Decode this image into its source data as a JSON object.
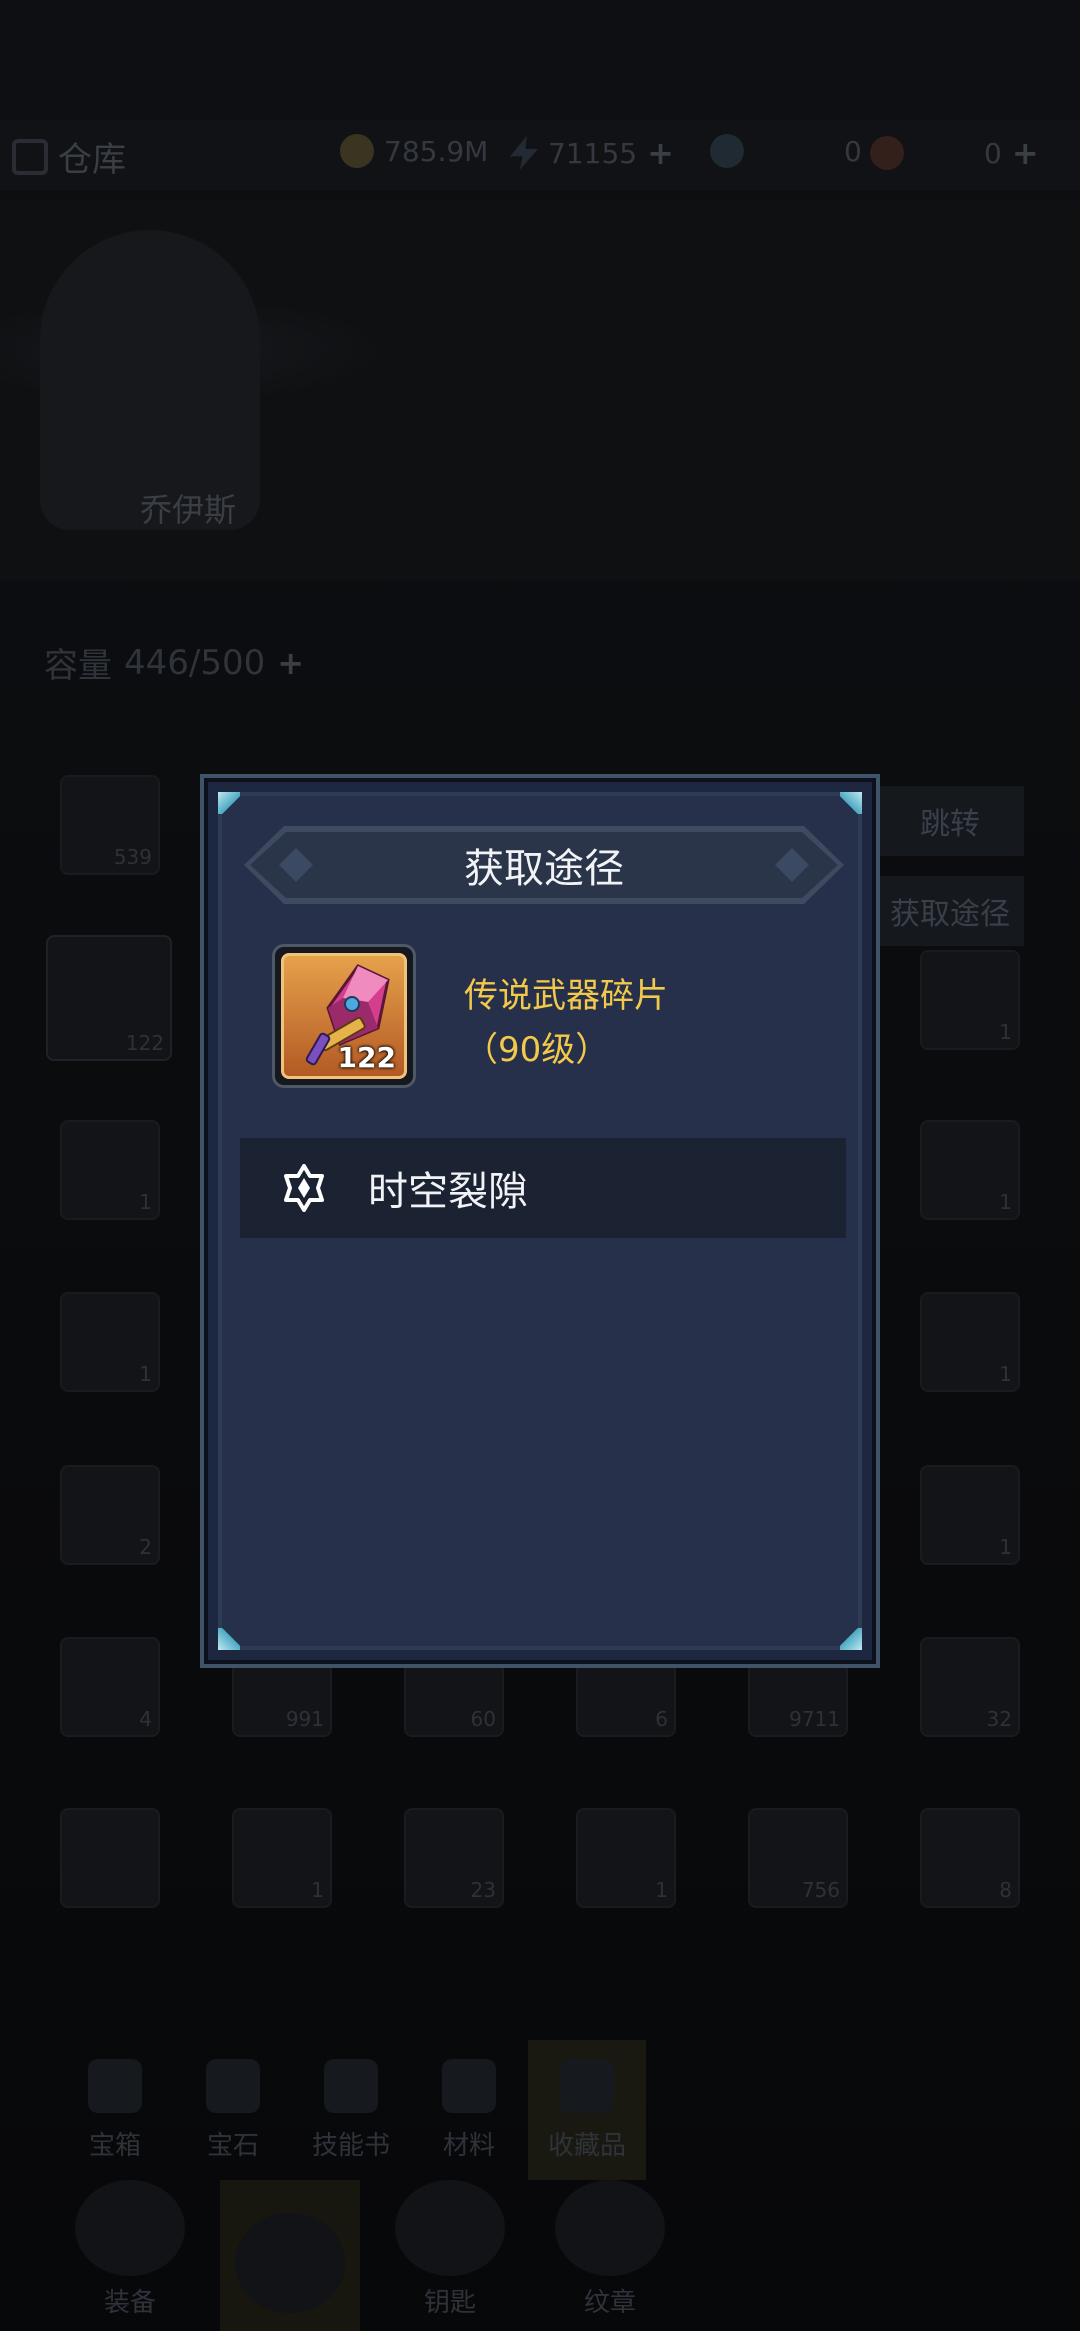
{
  "background": {
    "title": "仓库",
    "resources": [
      {
        "icon": "gold-coin-icon",
        "value": "785.9M"
      },
      {
        "icon": "energy-icon",
        "value": "71155"
      },
      {
        "icon": "gem-icon",
        "value": "0"
      },
      {
        "icon": "token-icon",
        "value": "0"
      }
    ],
    "hero_name": "乔伊斯",
    "capacity_label": "容量",
    "capacity_value": "446/500",
    "jump_label": "跳转",
    "source_btn_label": "获取途径",
    "slot_counts": [
      "539",
      "122",
      "1",
      "1",
      "1",
      "1",
      "1",
      "1",
      "2",
      "1",
      "4",
      "991",
      "60",
      "6",
      "9711",
      "32",
      "1",
      "23",
      "1",
      "756",
      "8"
    ],
    "nav_tabs": [
      "宝箱",
      "宝石",
      "技能书",
      "材料",
      "收藏品"
    ],
    "bottom_tabs": [
      "装备",
      "",
      "钥匙",
      "纹章"
    ]
  },
  "modal": {
    "title": "获取途径",
    "item": {
      "icon": "legendary-weapon-shard-icon",
      "count": "122",
      "name": "传说武器碎片",
      "level": "（90级）"
    },
    "sources": [
      {
        "icon": "spacetime-rift-icon",
        "label": "时空裂隙"
      }
    ]
  },
  "colors": {
    "modal_bg": "#26304a",
    "item_text": "#f2c94a",
    "title_text": "#f1f3f6",
    "frame_accent": "#4aa7c2"
  }
}
